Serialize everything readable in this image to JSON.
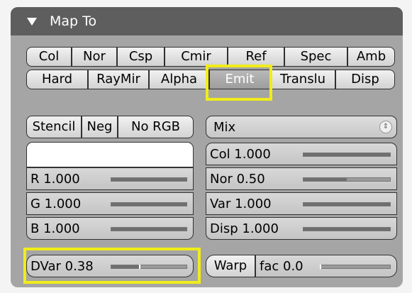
{
  "panel": {
    "title": "Map To"
  },
  "map_row1": [
    "Col",
    "Nor",
    "Csp",
    "Cmir",
    "Ref",
    "Spec",
    "Amb"
  ],
  "map_row2": [
    "Hard",
    "RayMir",
    "Alpha",
    "Emit",
    "Translu",
    "Disp"
  ],
  "active_map": "Emit",
  "options": {
    "stencil": "Stencil",
    "neg": "Neg",
    "no_rgb": "No RGB"
  },
  "blend": {
    "selected": "Mix"
  },
  "rgb": {
    "r": {
      "label": "R 1.000",
      "value": 1.0
    },
    "g": {
      "label": "G 1.000",
      "value": 1.0
    },
    "b": {
      "label": "B 1.000",
      "value": 1.0
    }
  },
  "factors": {
    "col": {
      "label": "Col 1.000",
      "value": 1.0
    },
    "nor": {
      "label": "Nor 0.50",
      "value": 0.5
    },
    "var": {
      "label": "Var 1.000",
      "value": 1.0
    },
    "disp": {
      "label": "Disp 1.000",
      "value": 1.0
    }
  },
  "dvar": {
    "label": "DVar 0.38",
    "value": 0.38
  },
  "warp": {
    "toggle": "Warp",
    "label": "fac 0.0",
    "value": 0.0
  },
  "colors": {
    "highlight": "#f0ec1b",
    "header": "#5e5e5e",
    "panel": "#a5a5a5"
  }
}
